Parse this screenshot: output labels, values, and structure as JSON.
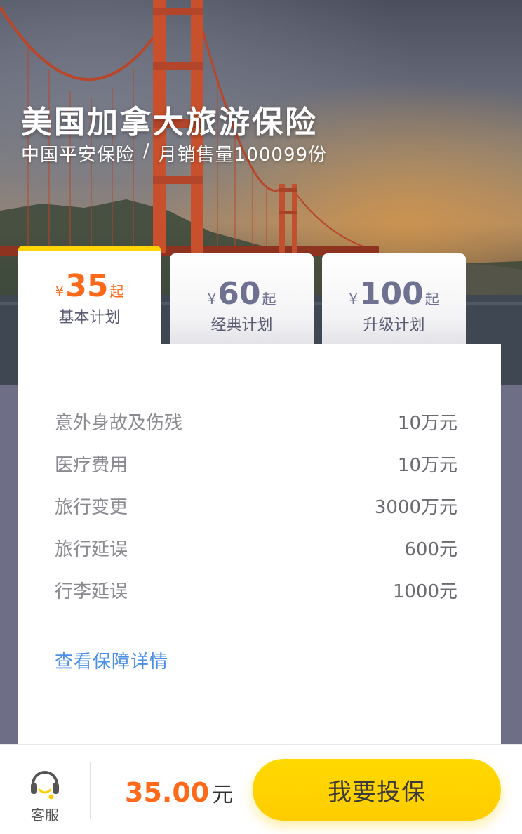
{
  "hero": {
    "title": "美国加拿大旅游保险",
    "company": "中国平安保险",
    "separator": "/",
    "sales": "月销售量100099份"
  },
  "plans": [
    {
      "currency": "¥",
      "price": "35",
      "suffix": "起",
      "name": "基本计划",
      "selected": true
    },
    {
      "currency": "¥",
      "price": "60",
      "suffix": "起",
      "name": "经典计划",
      "selected": false
    },
    {
      "currency": "¥",
      "price": "100",
      "suffix": "起",
      "name": "升级计划",
      "selected": false
    }
  ],
  "coverage": [
    {
      "item": "意外身故及伤残",
      "amount": "10万元"
    },
    {
      "item": "医疗费用",
      "amount": "10万元"
    },
    {
      "item": "旅行变更",
      "amount": "3000万元"
    },
    {
      "item": "旅行延误",
      "amount": "600元"
    },
    {
      "item": "行李延误",
      "amount": "1000元"
    }
  ],
  "detail_link": "查看保障详情",
  "bottom_bar": {
    "service_label": "客服",
    "service_icon": "headset-icon",
    "total_amount": "35.00",
    "total_unit": "元",
    "buy_label": "我要投保"
  },
  "colors": {
    "accent_yellow": "#ffd400",
    "price_orange": "#ff6a1a",
    "link_blue": "#4a8ee6",
    "page_background": "#6e6f86"
  }
}
